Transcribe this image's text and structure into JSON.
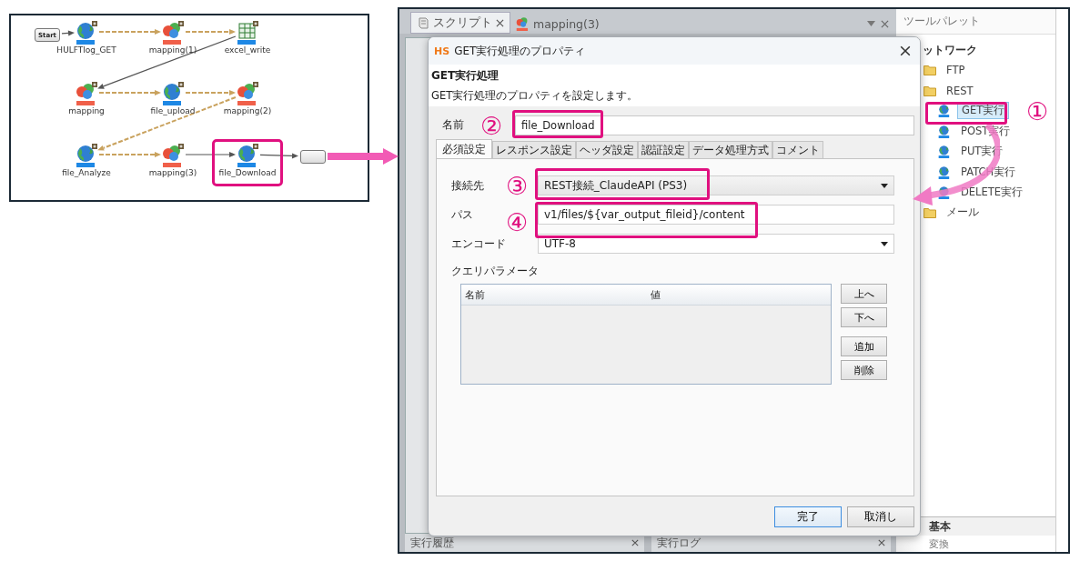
{
  "flow": {
    "nodes": [
      {
        "label": "Start",
        "kind": "start",
        "selected": false
      },
      {
        "label": "HULFTlog_GET",
        "kind": "rest",
        "dashed": false,
        "selected": false
      },
      {
        "label": "mapping(1)",
        "kind": "mapper",
        "dashed": true,
        "selected": false
      },
      {
        "label": "excel_write",
        "kind": "excel",
        "dashed": true,
        "selected": false
      },
      {
        "label": "mapping",
        "kind": "mapper",
        "dashed": false,
        "selected": false
      },
      {
        "label": "file_upload",
        "kind": "rest",
        "dashed": true,
        "selected": false
      },
      {
        "label": "mapping(2)",
        "kind": "mapper",
        "dashed": true,
        "selected": false
      },
      {
        "label": "file_Analyze",
        "kind": "rest",
        "dashed": true,
        "selected": false
      },
      {
        "label": "mapping(3)",
        "kind": "mapper",
        "dashed": true,
        "selected": false
      },
      {
        "label": "file_Download",
        "kind": "rest",
        "dashed": false,
        "selected": true
      },
      {
        "kind": "end",
        "dashed": false,
        "selected": false
      }
    ]
  },
  "editor": {
    "tabs": [
      {
        "label": "スクリプト",
        "kind": "script",
        "closable": true,
        "selected": true
      },
      {
        "label": "mapping(3)",
        "kind": "mapper",
        "closable": false,
        "selected": false
      }
    ],
    "bottom_tabs": [
      {
        "label": "実行履歴"
      },
      {
        "label": "実行ログ"
      }
    ]
  },
  "palette": {
    "title": "ツールパレット",
    "section": "ットワーク",
    "tree": [
      {
        "label": "FTP",
        "kind": "folder",
        "selected": false
      },
      {
        "label": "REST",
        "kind": "folder",
        "selected": false,
        "children": [
          {
            "label": "GET実行",
            "kind": "rest",
            "selected": true
          },
          {
            "label": "POST実行",
            "kind": "rest",
            "selected": false
          },
          {
            "label": "PUT実行",
            "kind": "rest",
            "selected": false
          },
          {
            "label": "PATCH実行",
            "kind": "rest",
            "selected": false
          },
          {
            "label": "DELETE実行",
            "kind": "rest",
            "selected": false
          }
        ]
      },
      {
        "label": "メール",
        "kind": "folder",
        "selected": false
      }
    ],
    "bottom_sections": [
      "基本",
      "変換"
    ]
  },
  "dialog": {
    "logo": "HS",
    "title": "GET実行処理のプロパティ",
    "heading": "GET実行処理",
    "description": "GET実行処理のプロパティを設定します。",
    "name_label": "名前",
    "name_value": "file_Download",
    "tabs": [
      {
        "label": "必須設定",
        "selected": true
      },
      {
        "label": "レスポンス設定",
        "selected": false
      },
      {
        "label": "ヘッダ設定",
        "selected": false
      },
      {
        "label": "認証設定",
        "selected": false
      },
      {
        "label": "データ処理方式",
        "selected": false
      },
      {
        "label": "コメント",
        "selected": false
      }
    ],
    "fields": [
      {
        "label": "接続先",
        "kind": "select",
        "value": "REST接続_ClaudeAPI (PS3)"
      },
      {
        "label": "パス",
        "kind": "text",
        "value": "v1/files/${var_output_fileid}/content"
      },
      {
        "label": "エンコード",
        "kind": "select",
        "value": "UTF-8"
      }
    ],
    "query": {
      "label": "クエリパラメータ",
      "columns": [
        "名前",
        "値"
      ],
      "buttons": [
        "上へ",
        "下へ",
        "追加",
        "削除"
      ]
    },
    "buttons": [
      {
        "label": "完了",
        "default": true
      },
      {
        "label": "取消し",
        "default": false
      }
    ]
  },
  "callouts": [
    "①",
    "②",
    "③",
    "④"
  ]
}
